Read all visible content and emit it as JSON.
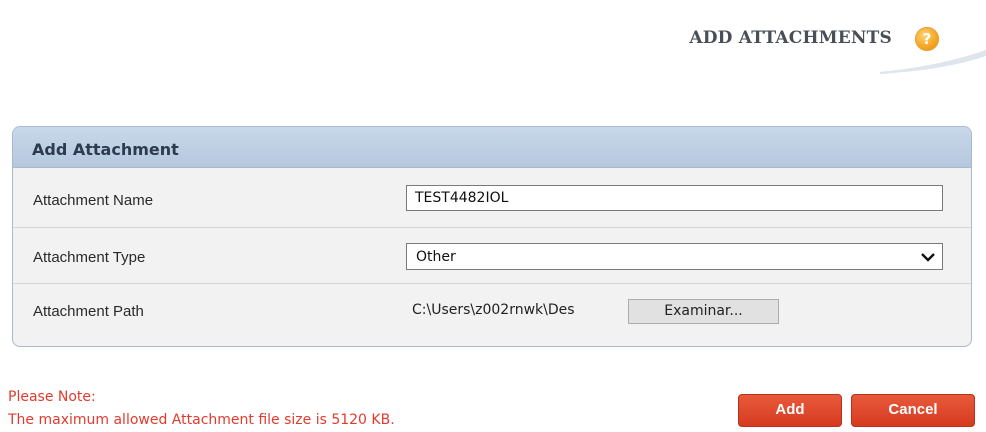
{
  "header": {
    "title": "ADD ATTACHMENTS",
    "help_symbol": "?"
  },
  "panel": {
    "title": "Add Attachment",
    "name_label": "Attachment Name",
    "name_value": "TEST4482IOL",
    "type_label": "Attachment Type",
    "type_value": "Other",
    "path_label": "Attachment Path",
    "path_value": "C:\\Users\\z002rnwk\\Des",
    "browse_label": "Examinar..."
  },
  "note": {
    "heading": "Please Note:",
    "text": "The maximum allowed Attachment file size is 5120 KB."
  },
  "actions": {
    "add_label": "Add",
    "cancel_label": "Cancel"
  },
  "colors": {
    "accent": "#d63a1f",
    "note_text": "#e23b2e",
    "panel_header": "#b5c8df",
    "help_icon": "#f5a623"
  },
  "icons": {
    "help": "help-icon",
    "dropdown": "chevron-down-icon"
  }
}
